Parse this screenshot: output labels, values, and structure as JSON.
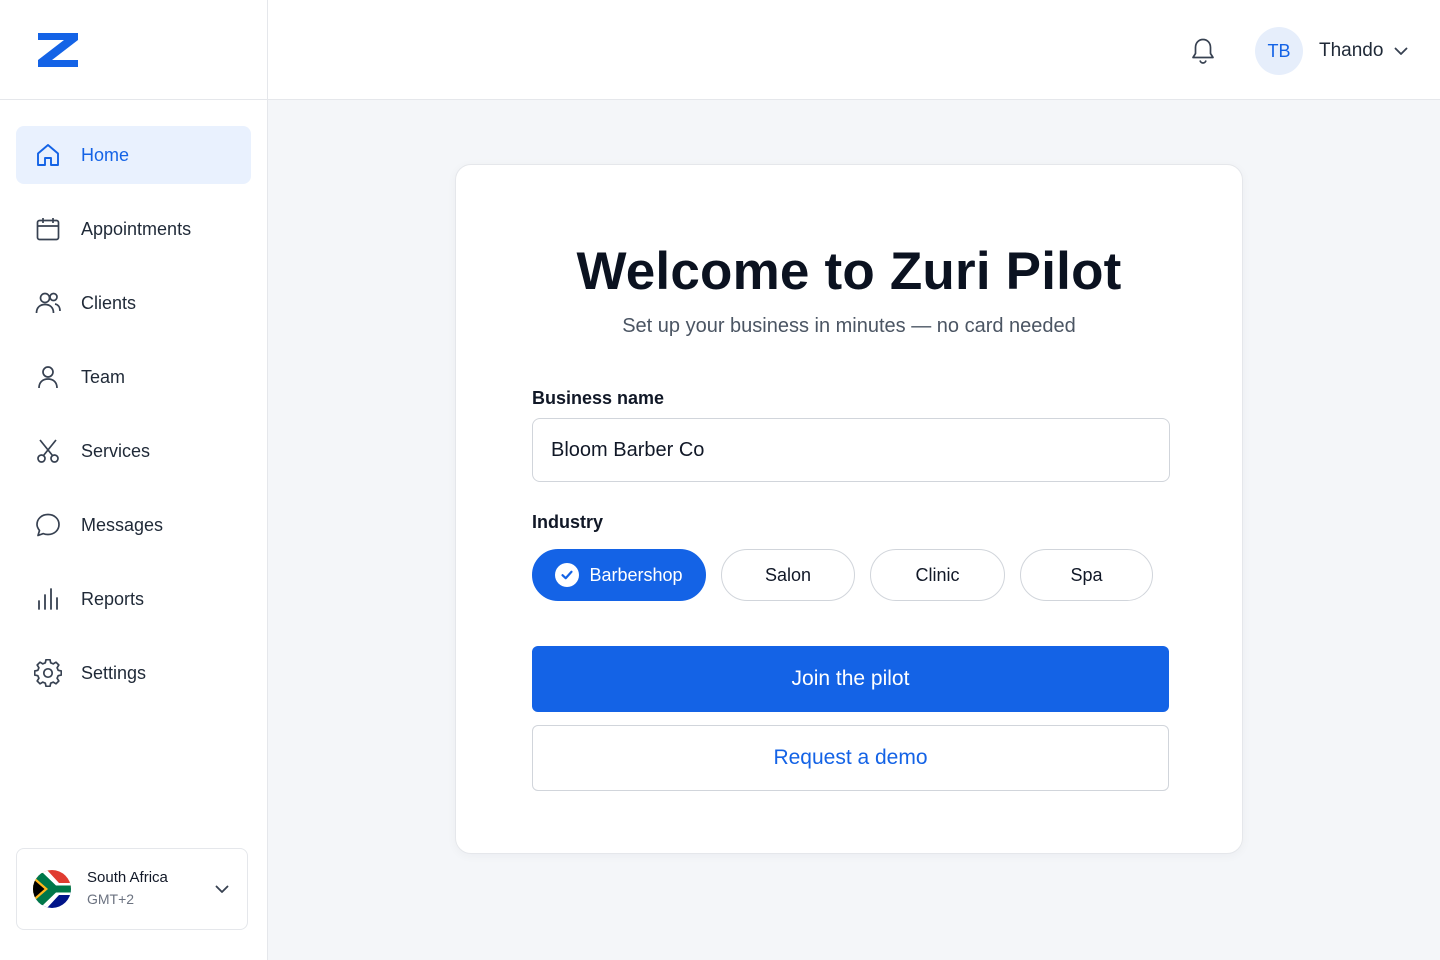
{
  "app": {
    "logo_icon": "zuri-z-logo",
    "brand_color": "#1463e6"
  },
  "sidebar": {
    "items": [
      {
        "label": "Home",
        "icon": "home-icon",
        "active": true
      },
      {
        "label": "Appointments",
        "icon": "calendar-icon",
        "active": false
      },
      {
        "label": "Clients",
        "icon": "users-icon",
        "active": false
      },
      {
        "label": "Team",
        "icon": "user-icon",
        "active": false
      },
      {
        "label": "Services",
        "icon": "scissors-icon",
        "active": false
      },
      {
        "label": "Messages",
        "icon": "message-icon",
        "active": false
      },
      {
        "label": "Reports",
        "icon": "bar-chart-icon",
        "active": false
      },
      {
        "label": "Settings",
        "icon": "gear-icon",
        "active": false
      }
    ],
    "region": {
      "country": "South Africa",
      "timezone": "GMT+2",
      "flag_icon": "south-africa-flag-icon"
    }
  },
  "header": {
    "notification_icon": "bell-icon",
    "avatar_initials": "TB",
    "user_name": "Thando"
  },
  "form": {
    "title": "Welcome to Zuri Pilot",
    "subtitle": "Set up your business in minutes — no card needed",
    "business_name_label": "Business name",
    "business_name_value": "Bloom Barber Co",
    "industry_label": "Industry",
    "industries": [
      {
        "label": "Barbershop",
        "selected": true
      },
      {
        "label": "Salon",
        "selected": false
      },
      {
        "label": "Clinic",
        "selected": false
      },
      {
        "label": "Spa",
        "selected": false
      }
    ],
    "primary_button": "Join the pilot",
    "secondary_button": "Request a demo"
  }
}
